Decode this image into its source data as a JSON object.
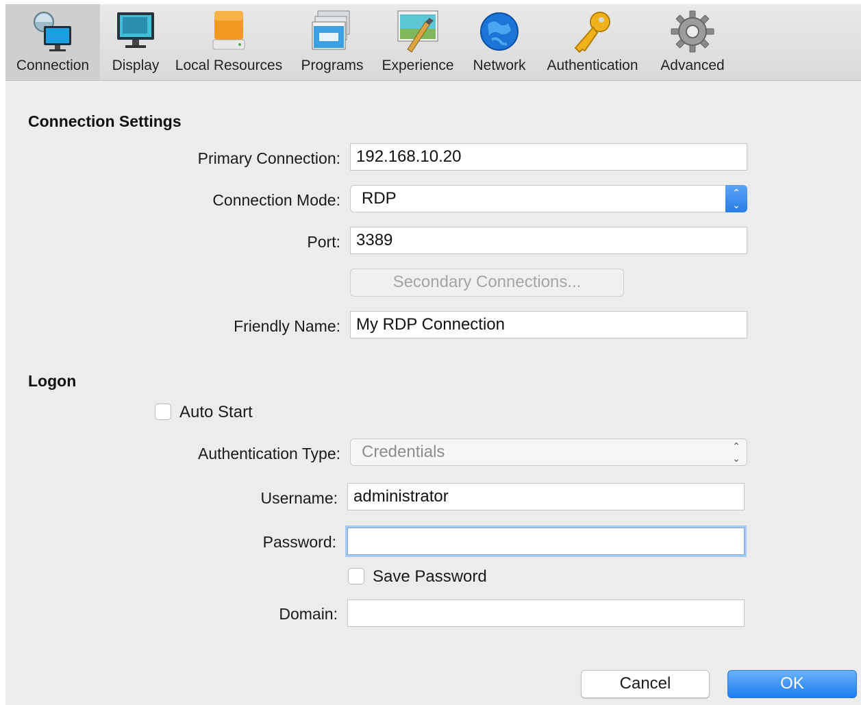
{
  "toolbar": {
    "tabs": [
      {
        "label": "Connection",
        "icon": "connection-icon",
        "active": true
      },
      {
        "label": "Display",
        "icon": "display-icon",
        "active": false
      },
      {
        "label": "Local Resources",
        "icon": "local-resources-icon",
        "active": false
      },
      {
        "label": "Programs",
        "icon": "programs-icon",
        "active": false
      },
      {
        "label": "Experience",
        "icon": "experience-icon",
        "active": false
      },
      {
        "label": "Network",
        "icon": "network-icon",
        "active": false
      },
      {
        "label": "Authentication",
        "icon": "authentication-icon",
        "active": false
      },
      {
        "label": "Advanced",
        "icon": "advanced-icon",
        "active": false
      }
    ]
  },
  "connection_settings": {
    "title": "Connection Settings",
    "primary_connection_label": "Primary Connection:",
    "primary_connection_value": "192.168.10.20",
    "connection_mode_label": "Connection Mode:",
    "connection_mode_value": "RDP",
    "port_label": "Port:",
    "port_value": "3389",
    "secondary_connections_button": "Secondary Connections...",
    "friendly_name_label": "Friendly Name:",
    "friendly_name_value": "My RDP Connection"
  },
  "logon": {
    "title": "Logon",
    "auto_start_label": "Auto Start",
    "auto_start_checked": false,
    "authentication_type_label": "Authentication Type:",
    "authentication_type_value": "Credentials",
    "username_label": "Username:",
    "username_value": "administrator",
    "password_label": "Password:",
    "password_value": "",
    "save_password_label": "Save Password",
    "save_password_checked": false,
    "domain_label": "Domain:",
    "domain_value": ""
  },
  "footer": {
    "cancel_label": "Cancel",
    "ok_label": "OK"
  },
  "colors": {
    "accent": "#2a7ce6",
    "focus_ring": "#a8c9f0",
    "background": "#ececec"
  }
}
